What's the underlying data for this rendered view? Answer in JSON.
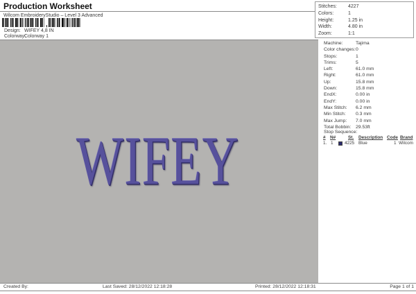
{
  "header": {
    "title": "Production Worksheet",
    "subtitle": "Wilcom EmbroideryStudio – Level 3 Advanced",
    "design_label": "Design:",
    "design_value": "WIFEY 4,8 IN",
    "colorway_label": "Colorway:",
    "colorway_value": "Colorway 1"
  },
  "summary": {
    "rows": [
      {
        "label": "Stitches:",
        "value": "4227"
      },
      {
        "label": "Colors:",
        "value": "1"
      },
      {
        "label": "Height:",
        "value": "1.25 in"
      },
      {
        "label": "Width:",
        "value": "4.80 in"
      },
      {
        "label": "Zoom:",
        "value": "1:1"
      }
    ]
  },
  "machine_info": {
    "rows": [
      {
        "label": "Machine:",
        "value": "Tajima"
      },
      {
        "label": "Color changes:",
        "value": "0"
      },
      {
        "label": "Stops:",
        "value": "1"
      },
      {
        "label": "Trims:",
        "value": "5"
      },
      {
        "label": "Left:",
        "value": "61.0 mm"
      },
      {
        "label": "Right:",
        "value": "61.0 mm"
      },
      {
        "label": "Up:",
        "value": "15.8 mm"
      },
      {
        "label": "Down:",
        "value": "15.8 mm"
      },
      {
        "label": "EndX:",
        "value": "0.00 in"
      },
      {
        "label": "EndY:",
        "value": "0.00 in"
      },
      {
        "label": "Max Stitch:",
        "value": "6.2 mm"
      },
      {
        "label": "Min Stitch:",
        "value": "0.3 mm"
      },
      {
        "label": "Max Jump:",
        "value": "7.0 mm"
      },
      {
        "label": "Total Bobbin:",
        "value": "29.53ft"
      }
    ]
  },
  "stop_sequence": {
    "title": "Stop Sequence:",
    "columns": {
      "num": "#",
      "n": "N#",
      "st": "St.",
      "description": "Description",
      "code": "Code",
      "brand": "Brand"
    },
    "row": {
      "num": "1.",
      "n": "1",
      "st": "4225",
      "description": "Blue",
      "code": "1",
      "brand": "Wilcom",
      "swatch_color": "#2b2b6e"
    }
  },
  "canvas": {
    "design_text": "WIFEY",
    "thread_color": "#57519c",
    "background_color": "#b4b3b1"
  },
  "footer": {
    "created_by": "Created By:",
    "last_saved": "Last Saved: 28/12/2022 12:18:28",
    "printed": "Printed: 28/12/2022 12:18:31",
    "page": "Page 1 of 1"
  }
}
